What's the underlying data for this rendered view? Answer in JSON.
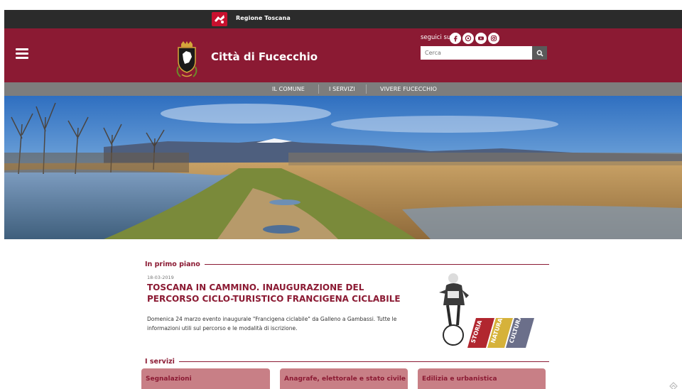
{
  "region_bar": {
    "name": "Regione Toscana"
  },
  "header": {
    "site_title": "Città di Fucecchio",
    "social_label": "seguici su:",
    "social_icons": [
      "facebook-icon",
      "whatsapp-icon",
      "youtube-icon",
      "instagram-icon"
    ],
    "search": {
      "placeholder": "Cerca"
    }
  },
  "nav": {
    "items": [
      "IL COMUNE",
      "I SERVIZI",
      "VIVERE FUCECCHIO"
    ]
  },
  "featured": {
    "heading": "In primo piano",
    "date": "18-03-2019",
    "title": "TOSCANA IN CAMMINO. INAUGURAZIONE DEL PERCORSO CICLO-TURISTICO FRANCIGENA CICLABILE",
    "text": "Domenica 24 marzo evento inaugurale \"Francigena ciclabile\" da Galleno a Gambassi. Tutte le informazioni utili sul percorso e le modalità di iscrizione.",
    "image_words": [
      "STORIA",
      "NATURA",
      "CULTURA"
    ]
  },
  "services": {
    "heading": "I servizi",
    "items": [
      "Segnalazioni",
      "Anagrafe, elettorale e stato civile",
      "Edilizia e urbanistica"
    ]
  },
  "colors": {
    "brand": "#8b1a33",
    "top_bar": "#2b2b2b",
    "nav_bar": "#7d7d7d",
    "service_card": "#c87f86"
  }
}
